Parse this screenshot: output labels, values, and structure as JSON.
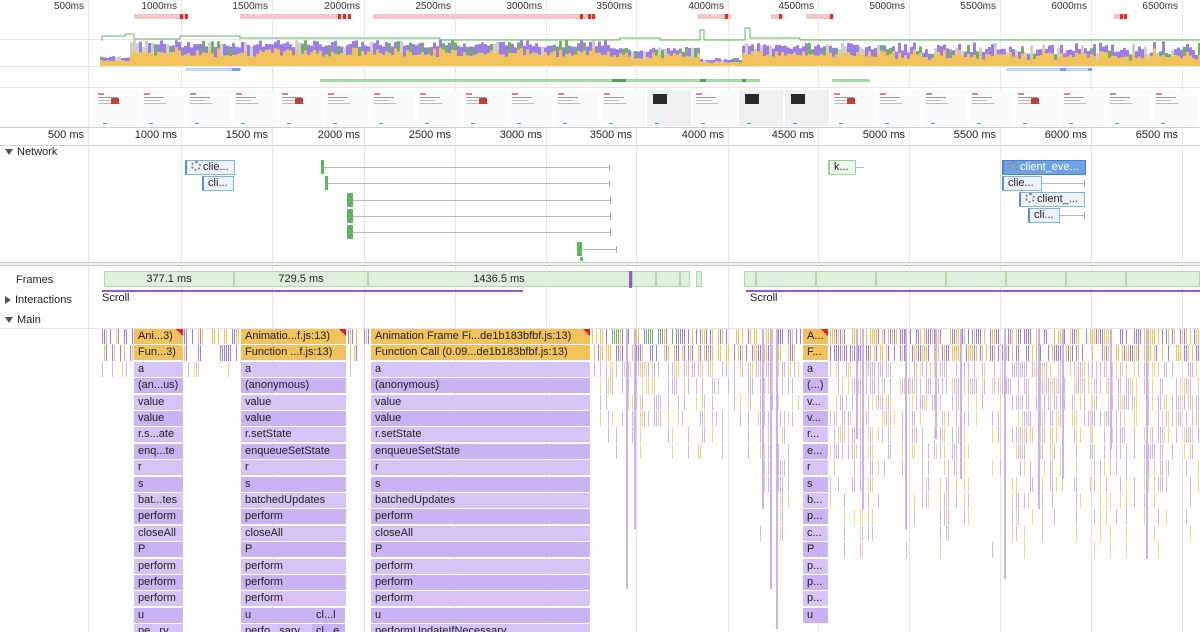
{
  "overview": {
    "tick_labels": [
      "500ms",
      "1000ms",
      "1500ms",
      "2000ms",
      "2500ms",
      "3000ms",
      "3500ms",
      "4000ms",
      "4500ms",
      "5000ms",
      "5500ms",
      "6000ms",
      "6500ms"
    ]
  },
  "ruler": {
    "tick_labels": [
      "500 ms",
      "1000 ms",
      "1500 ms",
      "2000 ms",
      "2500 ms",
      "3000 ms",
      "3500 ms",
      "4000 ms",
      "4500 ms",
      "5000 ms",
      "5500 ms",
      "6000 ms",
      "6500 ms"
    ]
  },
  "tracks": {
    "network": "Network",
    "frames": "Frames",
    "interactions": "Interactions",
    "main": "Main"
  },
  "network_requests": [
    {
      "label": "clie..."
    },
    {
      "label": "cli..."
    },
    {
      "label": "k..."
    },
    {
      "label": "client_eve..."
    },
    {
      "label": "clie..."
    },
    {
      "label": "client_..."
    },
    {
      "label": "cli..."
    }
  ],
  "frames": [
    "377.1 ms",
    "729.5 ms",
    "1436.5 ms"
  ],
  "interactions": [
    "Scroll",
    "Scroll"
  ],
  "main": {
    "columns": [
      {
        "rows": [
          "Ani...3)",
          "Fun...3)",
          "a",
          "(an...us)",
          "value",
          "value",
          "r.s...ate",
          "enq...te",
          "r",
          "s",
          "bat...tes",
          "perform",
          "closeAll",
          "P",
          "perform",
          "perform",
          "perform",
          "u",
          "pe...ry"
        ]
      },
      {
        "rows": [
          "Animatio...f.js:13)",
          "Function ...f.js:13)",
          "a",
          "(anonymous)",
          "value",
          "value",
          "r.setState",
          "enqueueSetState",
          "r",
          "s",
          "batchedUpdates",
          "perform",
          "closeAll",
          "P",
          "perform",
          "perform",
          "perform",
          "u",
          "perfo...sary"
        ],
        "extra": [
          "cl...l",
          "cl...e"
        ]
      },
      {
        "rows": [
          "Animation Frame Fi...de1b183bfbf.js:13)",
          "Function Call (0.09...de1b183bfbf.js:13)",
          "a",
          "(anonymous)",
          "value",
          "value",
          "r.setState",
          "enqueueSetState",
          "r",
          "s",
          "batchedUpdates",
          "perform",
          "closeAll",
          "P",
          "perform",
          "perform",
          "perform",
          "u",
          "performUpdateIfNecessary"
        ]
      },
      {
        "rows": [
          "A...",
          "F...",
          "a",
          "(...)",
          "v...",
          "v...",
          "r...",
          "e...",
          "r",
          "s",
          "b...",
          "p...",
          "c...",
          "P",
          "p...",
          "p...",
          "p...",
          "u"
        ]
      }
    ]
  },
  "colors": {
    "scripting": "#f2c25d",
    "rendering": "#9b7fe3",
    "painting": "#6fb06f",
    "idle": "#cfcfcf",
    "network": "#6fa2e3",
    "long_task": "#f4c6c6"
  }
}
